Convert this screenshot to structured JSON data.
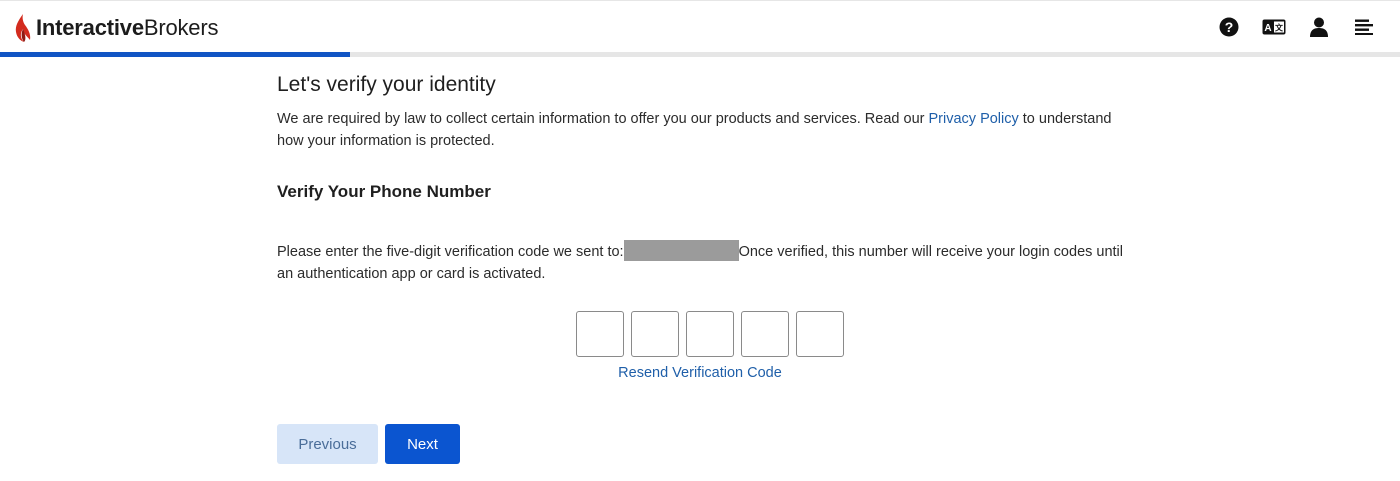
{
  "header": {
    "logo_bold": "Interactive",
    "logo_regular": "Brokers",
    "icons": [
      "help-icon",
      "language-icon",
      "user-icon",
      "menu-icon"
    ]
  },
  "progress": {
    "fraction": 0.25
  },
  "page": {
    "title": "Let's verify your identity",
    "intro_before": "We are required by law to collect certain information to offer you our products and services. Read our ",
    "privacy_link": "Privacy Policy",
    "intro_after": " to understand how your information is protected."
  },
  "phone": {
    "section_title": "Verify Your Phone Number",
    "instructions_before": "Please enter the five-digit verification code we sent to:",
    "instructions_after": "Once verified, this number will receive your login codes until an authentication app or card is activated.",
    "code_digits": [
      "",
      "",
      "",
      "",
      ""
    ],
    "resend_label": "Resend Verification Code"
  },
  "buttons": {
    "previous_label": "Previous",
    "next_label": "Next"
  },
  "colors": {
    "brand_blue": "#0b55d0",
    "link_blue": "#1f5fa9",
    "logo_red": "#d32b1e",
    "progress_blue": "#1155c4"
  }
}
